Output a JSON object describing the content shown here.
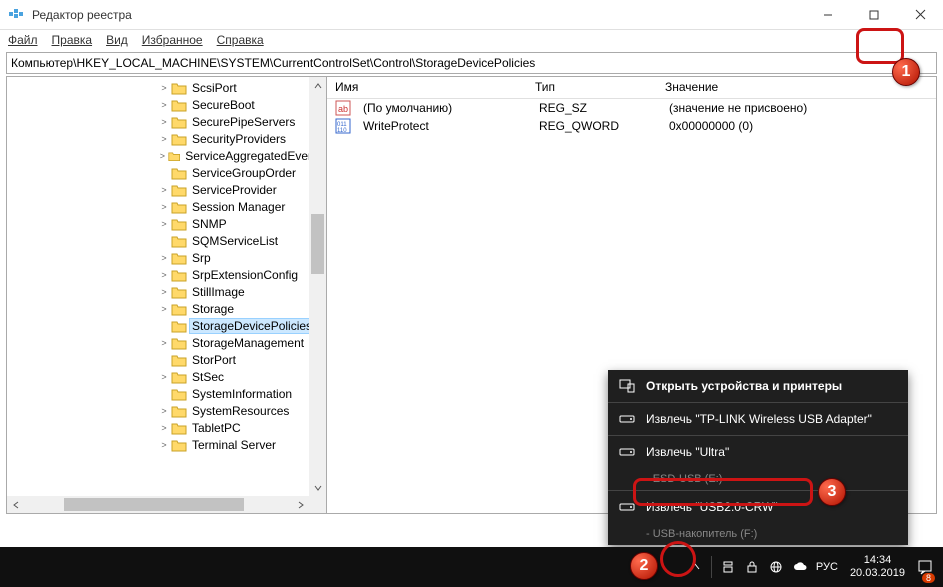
{
  "window": {
    "title": "Редактор реестра",
    "minimize_tip": "Свернуть",
    "maximize_tip": "Развернуть",
    "close_tip": "Закрыть"
  },
  "menu": {
    "file": "Файл",
    "edit": "Правка",
    "view": "Вид",
    "favorites": "Избранное",
    "help": "Справка"
  },
  "address": "Компьютер\\HKEY_LOCAL_MACHINE\\SYSTEM\\CurrentControlSet\\Control\\StorageDevicePolicies",
  "tree": {
    "items": [
      {
        "label": "ScsiPort",
        "indent": 150,
        "twisty": ">"
      },
      {
        "label": "SecureBoot",
        "indent": 150,
        "twisty": ">"
      },
      {
        "label": "SecurePipeServers",
        "indent": 150,
        "twisty": ">"
      },
      {
        "label": "SecurityProviders",
        "indent": 150,
        "twisty": ">"
      },
      {
        "label": "ServiceAggregatedEvents",
        "indent": 150,
        "twisty": ">"
      },
      {
        "label": "ServiceGroupOrder",
        "indent": 150,
        "twisty": ""
      },
      {
        "label": "ServiceProvider",
        "indent": 150,
        "twisty": ">"
      },
      {
        "label": "Session Manager",
        "indent": 150,
        "twisty": ">"
      },
      {
        "label": "SNMP",
        "indent": 150,
        "twisty": ">"
      },
      {
        "label": "SQMServiceList",
        "indent": 150,
        "twisty": ""
      },
      {
        "label": "Srp",
        "indent": 150,
        "twisty": ">"
      },
      {
        "label": "SrpExtensionConfig",
        "indent": 150,
        "twisty": ">"
      },
      {
        "label": "StillImage",
        "indent": 150,
        "twisty": ">"
      },
      {
        "label": "Storage",
        "indent": 150,
        "twisty": ">"
      },
      {
        "label": "StorageDevicePolicies",
        "indent": 150,
        "twisty": "",
        "selected": true
      },
      {
        "label": "StorageManagement",
        "indent": 150,
        "twisty": ">"
      },
      {
        "label": "StorPort",
        "indent": 150,
        "twisty": ""
      },
      {
        "label": "StSec",
        "indent": 150,
        "twisty": ">"
      },
      {
        "label": "SystemInformation",
        "indent": 150,
        "twisty": ""
      },
      {
        "label": "SystemResources",
        "indent": 150,
        "twisty": ">"
      },
      {
        "label": "TabletPC",
        "indent": 150,
        "twisty": ">"
      },
      {
        "label": "Terminal Server",
        "indent": 150,
        "twisty": ">"
      }
    ]
  },
  "list": {
    "headers": {
      "name": "Имя",
      "type": "Тип",
      "value": "Значение"
    },
    "rows": [
      {
        "icon": "sz",
        "name": "(По умолчанию)",
        "type": "REG_SZ",
        "value": "(значение не присвоено)"
      },
      {
        "icon": "bin",
        "name": "WriteProtect",
        "type": "REG_QWORD",
        "value": "0x00000000 (0)"
      }
    ]
  },
  "eject": {
    "open_devices": "Открыть устройства и принтеры",
    "item1": "Извлечь \"TP-LINK Wireless USB Adapter\"",
    "item2": "Извлечь \"Ultra\"",
    "item2_sub": "-   ESD-USB (E:)",
    "item3": "Извлечь \"USB2.0-CRW\"",
    "item3_sub": " - USB-накопитель (F:)"
  },
  "tray": {
    "lang": "РУС",
    "time": "14:34",
    "date": "20.03.2019",
    "notif_count": "8"
  }
}
